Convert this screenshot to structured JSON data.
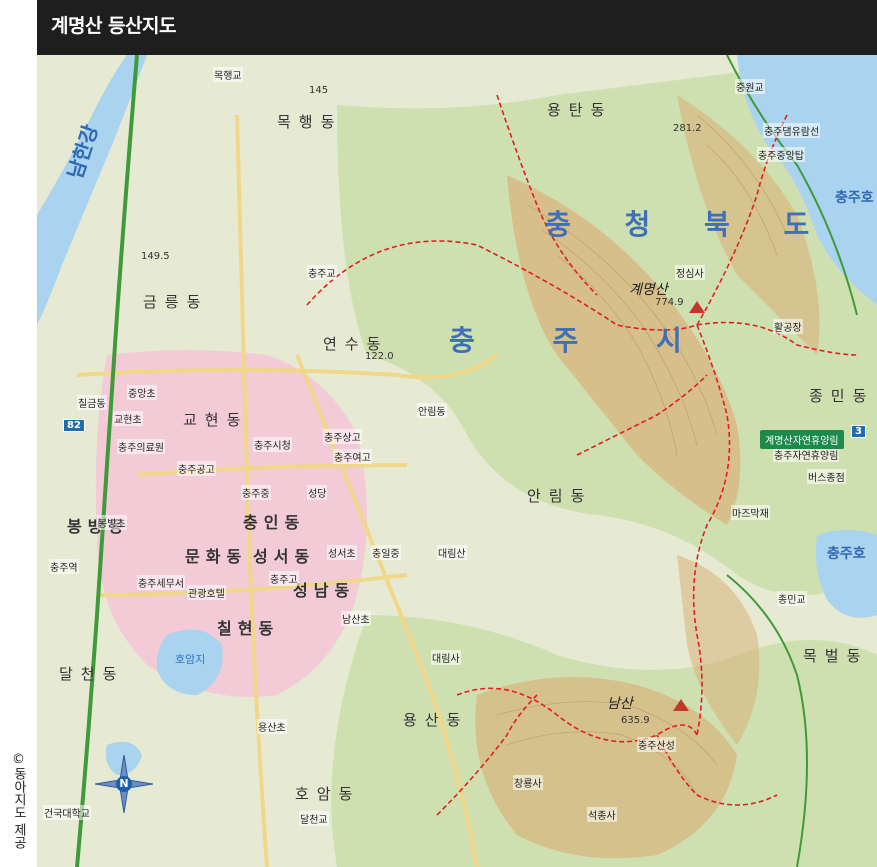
{
  "header": {
    "title": "계명산 등산지도"
  },
  "credit": "©동아지도 제공",
  "colors": {
    "header_bg": "#1e1e1e",
    "terrain": "#e7ead2",
    "forest": "#cfe0b0",
    "ridge": "#d8b07a",
    "urban": "#f3c6d8",
    "water": "#a9d3ef",
    "trail": "#e02020",
    "road": "#f0d78a",
    "highway": "#3f9a3a",
    "label_blue": "#3f6fb8"
  },
  "map": {
    "region_labels": {
      "province": "충 청 북 도",
      "city": "충 주 시"
    },
    "rivers": [
      {
        "name": "남한강"
      },
      {
        "name": "충주호"
      },
      {
        "name": "충주호"
      }
    ],
    "peaks": [
      {
        "name": "계명산",
        "elevation": "774.9"
      },
      {
        "name": "남산",
        "elevation": "635.9"
      },
      {
        "elevation": "281.2"
      },
      {
        "elevation": "149.5"
      },
      {
        "elevation": "122.0"
      },
      {
        "elevation": "145"
      }
    ],
    "dong_labels": [
      "용탄동",
      "목행동",
      "금릉동",
      "연수동",
      "종민동",
      "안림동",
      "봉방동",
      "문화동",
      "성서동",
      "성남동",
      "교현동",
      "충인동",
      "칠현동",
      "달천동",
      "용산동",
      "목벌동",
      "호암동"
    ],
    "places": [
      "중원교",
      "충주댐유람선",
      "충주중앙탑",
      "마즈막재",
      "정심사",
      "활공장",
      "대림산",
      "충주시청",
      "충주교",
      "호암지",
      "대림사",
      "충주산성",
      "창룡사",
      "석종사",
      "충주의료원",
      "충주여고",
      "충주고",
      "충주중",
      "충주공고",
      "건국대학교",
      "충주자연휴양림",
      "버스종점",
      "충주역",
      "안림동",
      "목행교",
      "달천교",
      "교현초",
      "중앙초",
      "용산초",
      "충일중",
      "충주상고",
      "칠금동",
      "종민교",
      "충주세무서",
      "성당",
      "성서초",
      "남산초",
      "관광호텔",
      "봉방초"
    ],
    "park_badge": "계명산자연휴양림",
    "route_badges": [
      "82",
      "3"
    ],
    "compass": "N"
  }
}
